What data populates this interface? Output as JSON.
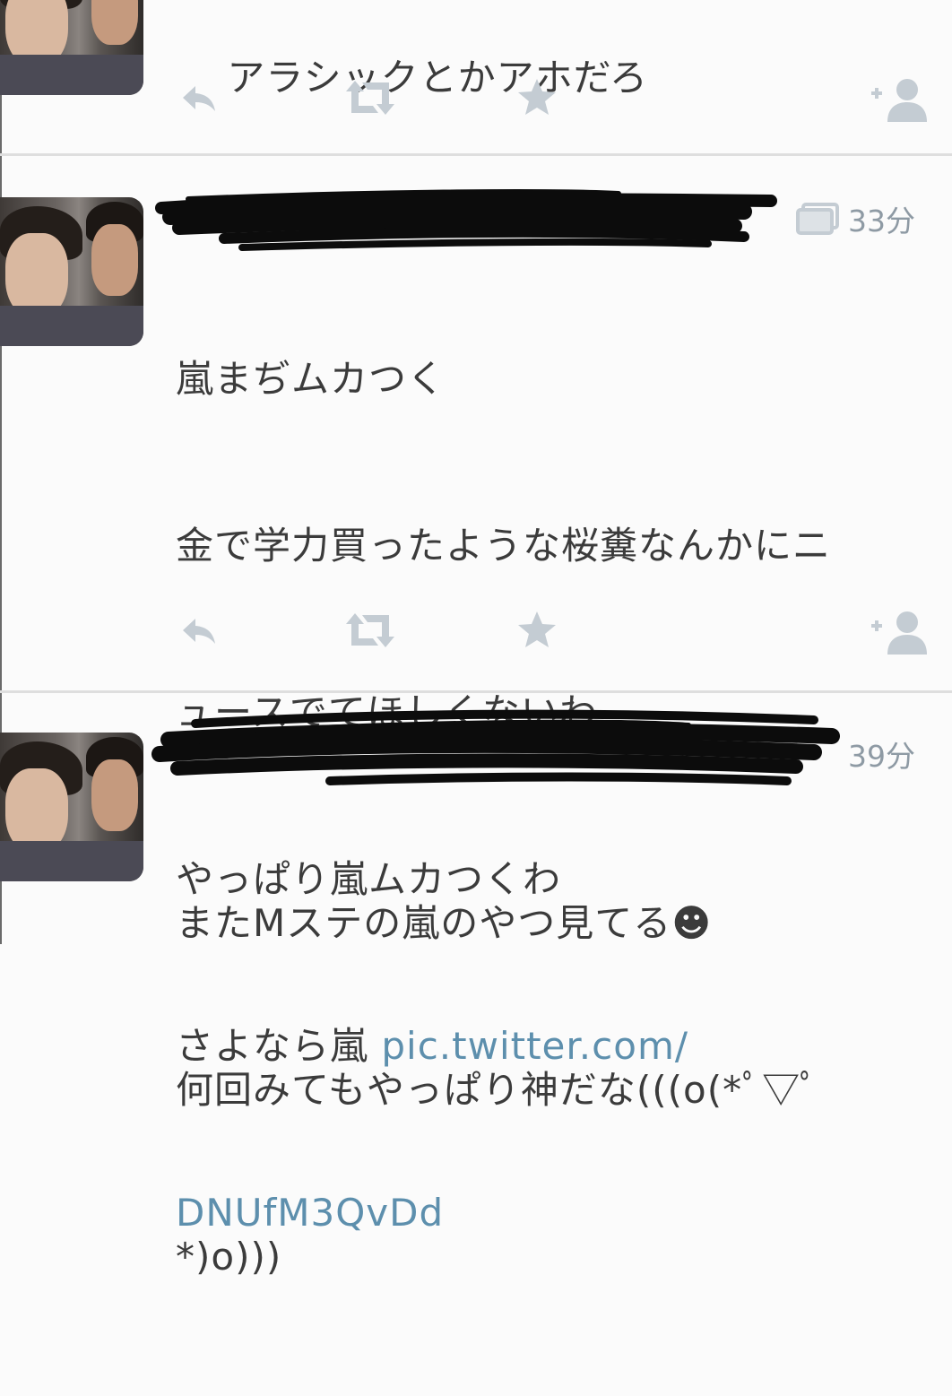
{
  "timeline": {
    "tweets": [
      {
        "lines": [
          "アラシックとかアホだろ"
        ]
      },
      {
        "time": "33分",
        "lines": [
          "嵐まぢムカつく",
          "金で学力買ったような桜糞なんかにニ",
          "ュースでてほしくないわ",
          "やっぱり嵐ムカつくわ"
        ],
        "last_line_text": "さよなら嵐 ",
        "link_part1": "pic.twitter.com/",
        "link_part2": "DNUfM3QvDd",
        "has_media_icon": true
      },
      {
        "time": "39分",
        "lines": [
          "またMステの嵐のやつ見てる☻",
          "何回みてもやっぱり神だな(((o(*ﾟ▽ﾟ",
          "*)o)))"
        ]
      }
    ]
  },
  "icons": {
    "reply": "reply-icon",
    "retweet": "retweet-icon",
    "favorite": "star-icon",
    "follow": "follow-user-icon",
    "media": "image-icon"
  },
  "colors": {
    "action_icon": "#c4ccd3",
    "link": "#5d8fad",
    "time": "#8e9aa4",
    "text": "#3b3b3b"
  }
}
